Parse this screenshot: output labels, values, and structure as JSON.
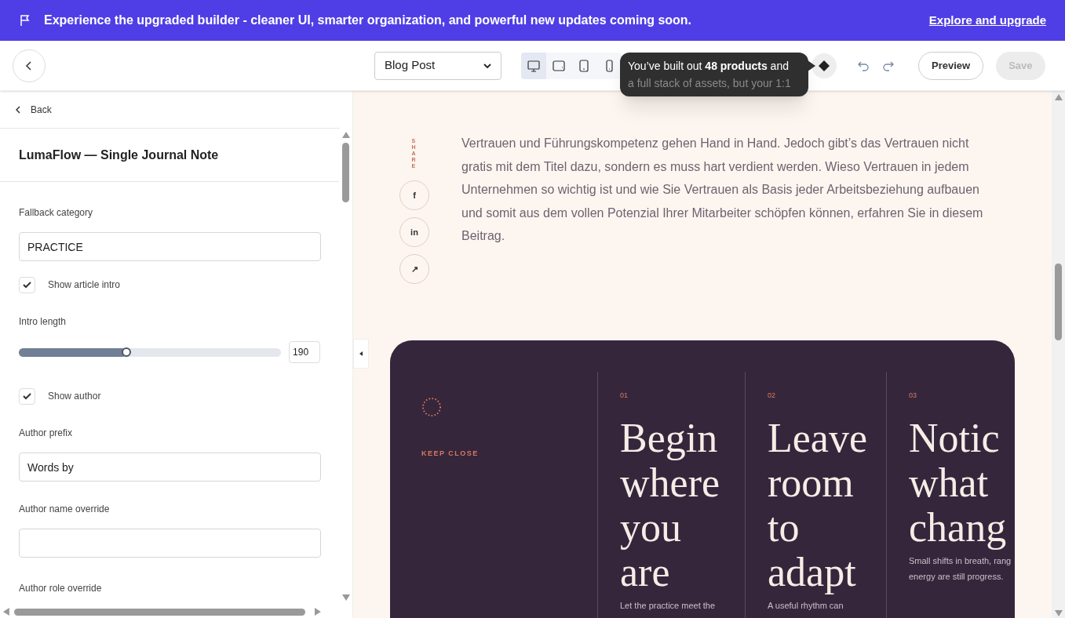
{
  "banner": {
    "message": "Experience the upgraded builder - cleaner UI, smarter organization, and powerful new updates coming soon.",
    "link": "Explore and upgrade"
  },
  "toolbar": {
    "template_select": "Blog Post",
    "devices": [
      {
        "kind": "desktop",
        "selected": true
      },
      {
        "kind": "laptop",
        "selected": false
      },
      {
        "kind": "tablet",
        "selected": false
      },
      {
        "kind": "phone",
        "selected": false
      }
    ],
    "tooltip": {
      "line_1": "You’ve built out **48 products** and",
      "line_2": "a full stack of assets, but your 1:1"
    },
    "preview": "Preview",
    "save": {
      "label": "Save",
      "disabled": true
    }
  },
  "sidebar": {
    "back": "Back",
    "title": "LumaFlow — Single Journal Note",
    "fields": [
      {
        "kind": "text",
        "label": "Fallback category",
        "value": "PRACTICE"
      },
      {
        "kind": "checkbox",
        "label": "Show article intro",
        "checked": true
      },
      {
        "kind": "slider",
        "label": "Intro length",
        "level": 0.41,
        "value": "190"
      },
      {
        "kind": "checkbox",
        "label": "Show author",
        "checked": true
      },
      {
        "kind": "text",
        "label": "Author prefix",
        "value": "Words by"
      },
      {
        "kind": "text",
        "label": "Author name override"
      },
      {
        "kind": "heading",
        "label": "Author role override"
      }
    ]
  },
  "canvas": {
    "share_label": "SHARE",
    "share_buttons": [
      "f",
      "in",
      "↗"
    ],
    "intro": "Vertrauen und Führungskompetenz gehen Hand in Hand. Jedoch gibt’s das Vertrauen nicht gratis mit dem Titel dazu, sondern es muss hart verdient werden. Wieso Vertrauen in jedem Unternehmen so wichtig ist und wie Sie Vertrauen als Basis jeder Arbeitsbeziehung aufbauen und somit aus dem vollen Potenzial Ihrer Mitarbeiter schöpfen können, erfahren Sie in diesem Beitrag.",
    "card": {
      "eyebrow": "KEEP CLOSE",
      "steps": [
        {
          "number": "01",
          "title": "Begin where you are",
          "text": "Let the practice meet the"
        },
        {
          "number": "02",
          "title": "Leave room to adapt",
          "text": "A useful rhythm can"
        },
        {
          "number": "03",
          "title": "Notic what chang",
          "text": "Small shifts in breath, rang energy are still progress."
        }
      ]
    }
  }
}
